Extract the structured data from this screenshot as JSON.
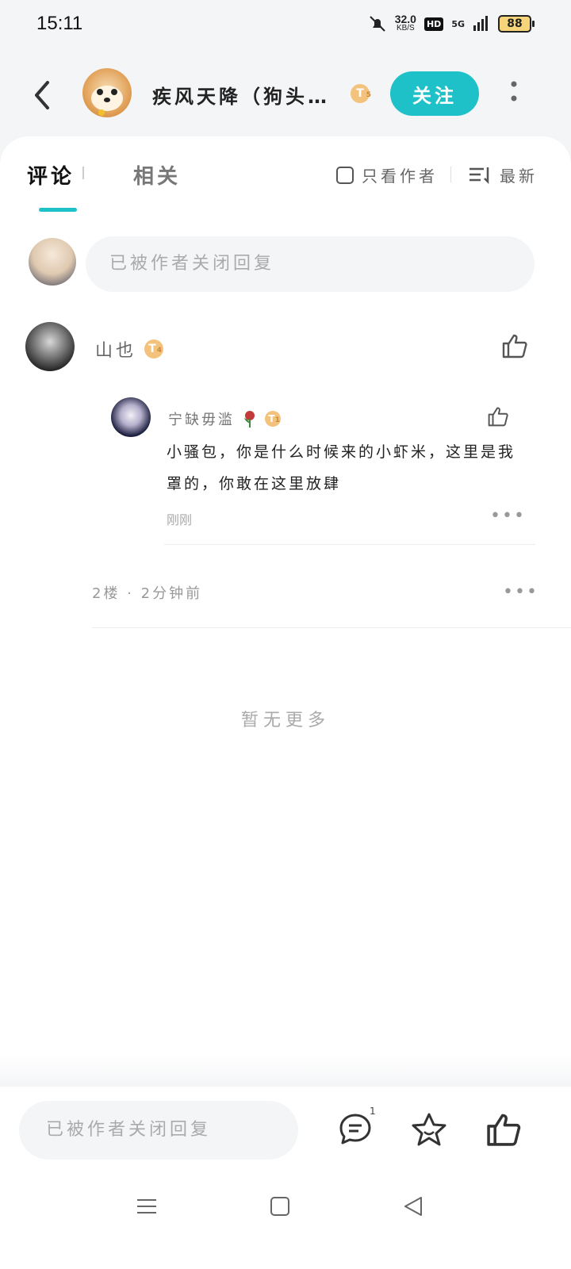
{
  "status": {
    "time": "15:11",
    "speed_value": "32.0",
    "speed_unit": "KB/S",
    "hd": "HD",
    "network": "5G",
    "battery": "88"
  },
  "header": {
    "author_name": "疾风天降（狗头保…",
    "author_level": "T",
    "author_level_num": "5",
    "follow_label": "关注"
  },
  "tabs": {
    "comments": "评论",
    "related": "相关",
    "author_only": "只看作者",
    "sort": "最新"
  },
  "reply_placeholder": "已被作者关闭回复",
  "comment": {
    "user": "山也",
    "level": "T",
    "level_num": "4",
    "meta": "2楼 · 2分钟前",
    "reply": {
      "user": "宁缺毋滥",
      "level": "T",
      "level_num": "1",
      "text": "小骚包，你是什么时候来的小虾米，这里是我罩的，你敢在这里放肆",
      "time": "刚刚"
    }
  },
  "no_more": "暂无更多",
  "bottom": {
    "placeholder": "已被作者关闭回复",
    "comment_count": "1"
  },
  "colors": {
    "accent": "#1fc1c9",
    "badge": "#f3c27c"
  }
}
